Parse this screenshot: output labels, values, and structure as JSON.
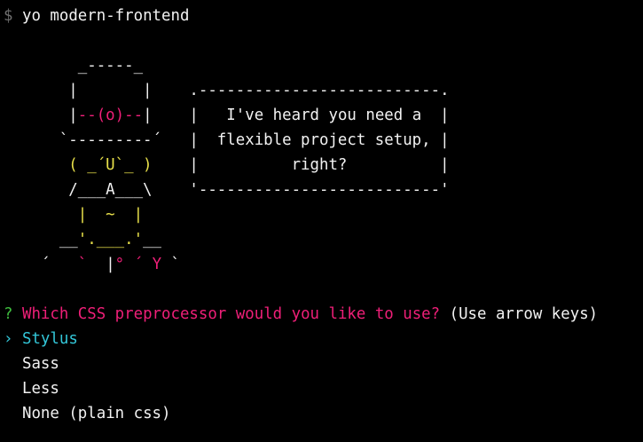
{
  "terminal": {
    "prompt_symbol": "$",
    "command": "yo modern-frontend"
  },
  "ascii_art": {
    "lines": [
      [
        {
          "text": "        _-----_",
          "color": "white"
        }
      ],
      [
        {
          "text": "       |       |    ",
          "color": "white"
        },
        {
          "text": ".--------------------------.",
          "color": "white"
        }
      ],
      [
        {
          "text": "       |",
          "color": "white"
        },
        {
          "text": "--(o)--",
          "color": "magenta"
        },
        {
          "text": "|",
          "color": "white"
        },
        {
          "text": "    |   I've heard you need a  |",
          "color": "white"
        }
      ],
      [
        {
          "text": "      `---------´   |  flexible project setup, |",
          "color": "white"
        }
      ],
      [
        {
          "text": "       ",
          "color": "white"
        },
        {
          "text": "( _´U`_ )",
          "color": "yellow"
        },
        {
          "text": "    |          right?          |",
          "color": "white"
        }
      ],
      [
        {
          "text": "       /___A___\\    '--------------------------'",
          "color": "white"
        }
      ],
      [
        {
          "text": "        ",
          "color": "white"
        },
        {
          "text": "|  ~  |",
          "color": "yellow"
        }
      ],
      [
        {
          "text": "      __",
          "color": "white"
        },
        {
          "text": "'.___.'",
          "color": "yellow"
        },
        {
          "text": "__",
          "color": "white"
        }
      ],
      [
        {
          "text": "    ´   ",
          "color": "white"
        },
        {
          "text": "`",
          "color": "magenta"
        },
        {
          "text": "  |",
          "color": "white"
        },
        {
          "text": "°",
          "color": "magenta"
        },
        {
          "text": " ",
          "color": "white"
        },
        {
          "text": "´ Y",
          "color": "magenta"
        },
        {
          "text": " `",
          "color": "white"
        }
      ]
    ]
  },
  "question": {
    "marker": "?",
    "text": "Which CSS preprocessor would you like to use?",
    "hint": "(Use arrow keys)"
  },
  "options": {
    "pointer": "›",
    "items": [
      {
        "label": "Stylus",
        "selected": true
      },
      {
        "label": "Sass",
        "selected": false
      },
      {
        "label": "Less",
        "selected": false
      },
      {
        "label": "None (plain css)",
        "selected": false
      }
    ]
  },
  "colors": {
    "background": "#000000",
    "text": "#f2f2f2",
    "prompt": "#6e6e6e",
    "yellow": "#e8e04a",
    "magenta": "#ef1f78",
    "cyan": "#33c7d9",
    "green": "#3fbf3f"
  }
}
